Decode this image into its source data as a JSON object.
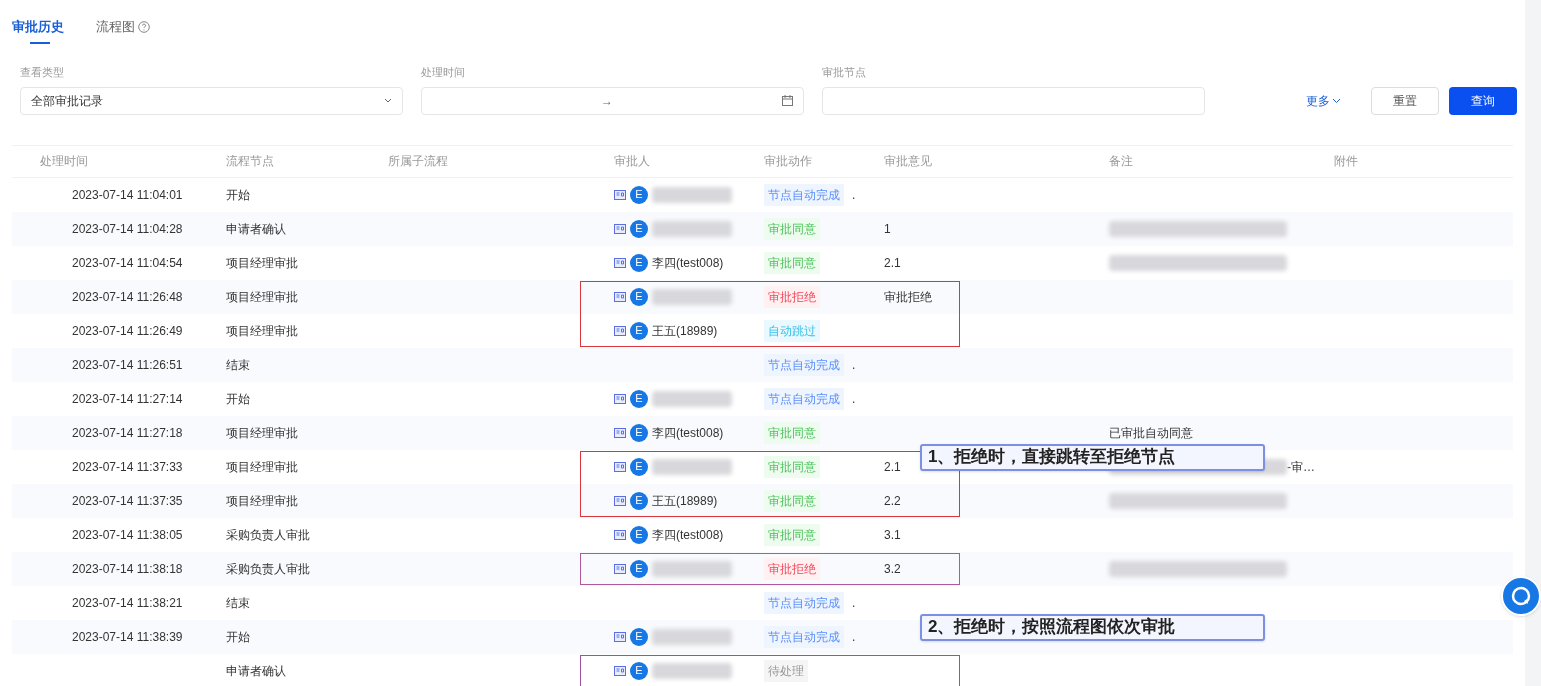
{
  "tabs": [
    {
      "label": "审批历史",
      "selected": true,
      "help": false
    },
    {
      "label": "流程图",
      "selected": false,
      "help": true
    }
  ],
  "filters": {
    "type": {
      "label": "查看类型",
      "value": "全部审批记录"
    },
    "time": {
      "label": "处理时间",
      "separator": "→"
    },
    "node": {
      "label": "审批节点"
    },
    "more": "更多",
    "reset": "重置",
    "query": "查询"
  },
  "table": {
    "columns": [
      "处理时间",
      "流程节点",
      "所属子流程",
      "审批人",
      "审批动作",
      "审批意见",
      "备注",
      "附件"
    ],
    "rows": [
      {
        "time": "2023-07-14 11:04:01",
        "node": "开始",
        "approver": {
          "avatar": "E",
          "redacted": true
        },
        "action": {
          "kind": "auto",
          "label": "节点自动完成",
          "suffix": "."
        }
      },
      {
        "time": "2023-07-14 11:04:28",
        "node": "申请者确认",
        "approver": {
          "avatar": "E",
          "redacted": true
        },
        "action": {
          "kind": "approve",
          "label": "审批同意"
        },
        "opinion": "1",
        "remark_redacted": true
      },
      {
        "time": "2023-07-14 11:04:54",
        "node": "项目经理审批",
        "approver": {
          "avatar": "E",
          "name": "李四(test008)"
        },
        "action": {
          "kind": "approve",
          "label": "审批同意"
        },
        "opinion": "2.1",
        "remark_redacted": true
      },
      {
        "time": "2023-07-14 11:26:48",
        "node": "项目经理审批",
        "approver": {
          "avatar": "E",
          "redacted": true
        },
        "action": {
          "kind": "reject",
          "label": "审批拒绝"
        },
        "opinion": "审批拒绝",
        "color": "#d9363e"
      },
      {
        "time": "2023-07-14 11:26:49",
        "node": "项目经理审批",
        "approver": {
          "avatar": "E",
          "name": "王五(18989)"
        },
        "action": {
          "kind": "skip",
          "label": "自动跳过"
        },
        "color": "#d9363e"
      },
      {
        "time": "2023-07-14 11:26:51",
        "node": "结束",
        "action": {
          "kind": "auto",
          "label": "节点自动完成",
          "suffix": "."
        }
      },
      {
        "time": "2023-07-14 11:27:14",
        "node": "开始",
        "approver": {
          "avatar": "E",
          "redacted": true
        },
        "action": {
          "kind": "auto",
          "label": "节点自动完成",
          "suffix": "."
        }
      },
      {
        "time": "2023-07-14 11:27:18",
        "node": "项目经理审批",
        "approver": {
          "avatar": "E",
          "name": "李四(test008)"
        },
        "action": {
          "kind": "approve",
          "label": "审批同意"
        },
        "remark": "已审批自动同意"
      },
      {
        "time": "2023-07-14 11:37:33",
        "node": "项目经理审批",
        "approver": {
          "avatar": "E",
          "redacted": true
        },
        "action": {
          "kind": "approve",
          "label": "审批同意"
        },
        "opinion": "2.1",
        "remark_redacted": true,
        "remark": "-审…",
        "color": "#d9363e",
        "callout": "1、拒绝时，直接跳转至拒绝节点"
      },
      {
        "time": "2023-07-14 11:37:35",
        "node": "项目经理审批",
        "approver": {
          "avatar": "E",
          "name": "王五(18989)"
        },
        "action": {
          "kind": "approve",
          "label": "审批同意"
        },
        "opinion": "2.2",
        "remark_redacted": true,
        "color": "#d9363e"
      },
      {
        "time": "2023-07-14 11:38:05",
        "node": "采购负责人审批",
        "approver": {
          "avatar": "E",
          "name": "李四(test008)"
        },
        "action": {
          "kind": "approve",
          "label": "审批同意"
        },
        "opinion": "3.1"
      },
      {
        "time": "2023-07-14 11:38:18",
        "node": "采购负责人审批",
        "approver": {
          "avatar": "E",
          "redacted": true
        },
        "action": {
          "kind": "reject",
          "label": "审批拒绝"
        },
        "opinion": "3.2",
        "remark_redacted": true,
        "color": "#b0589c"
      },
      {
        "time": "2023-07-14 11:38:21",
        "node": "结束",
        "action": {
          "kind": "auto",
          "label": "节点自动完成",
          "suffix": "."
        }
      },
      {
        "time": "2023-07-14 11:38:39",
        "node": "开始",
        "approver": {
          "avatar": "E",
          "redacted": true
        },
        "action": {
          "kind": "auto",
          "label": "节点自动完成",
          "suffix": "."
        },
        "callout": "2、拒绝时，按照流程图依次审批"
      },
      {
        "node": "申请者确认",
        "approver": {
          "avatar": "E",
          "redacted": true
        },
        "action": {
          "kind": "pending",
          "label": "待处理"
        },
        "color": "#a0509a"
      }
    ]
  }
}
